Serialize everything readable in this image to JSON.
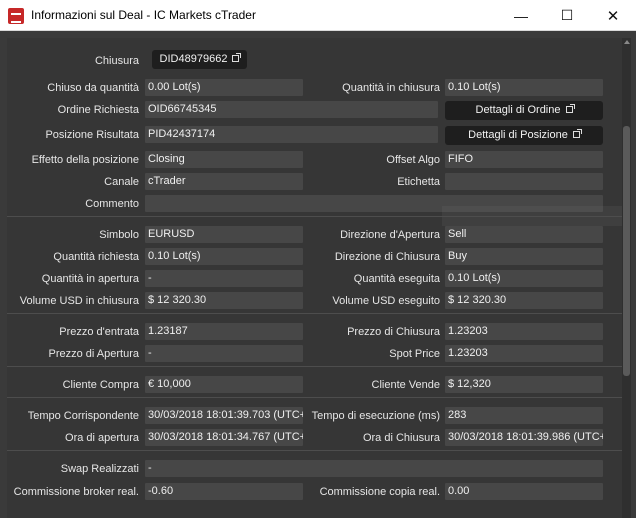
{
  "window": {
    "title": "Informazioni sul Deal - IC Markets cTrader",
    "minimize": "—",
    "maximize": "☐",
    "close": "✕"
  },
  "chiusura": {
    "label": "Chiusura",
    "deal_id": "DID48979662"
  },
  "rows": {
    "chiuso_quantita": {
      "label": "Chiuso da quantità",
      "value": "0.00 Lot(s)"
    },
    "quantita_chiusura": {
      "label": "Quantità in chiusura",
      "value": "0.10 Lot(s)"
    },
    "ordine_richiesta": {
      "label": "Ordine Richiesta",
      "value": "OID66745345"
    },
    "posizione_risultata": {
      "label": "Posizione Risultata",
      "value": "PID42437174"
    },
    "effetto_posizione": {
      "label": "Effetto della posizione",
      "value": "Closing"
    },
    "offset_algo": {
      "label": "Offset Algo",
      "value": "FIFO"
    },
    "canale": {
      "label": "Canale",
      "value": "cTrader"
    },
    "etichetta": {
      "label": "Etichetta",
      "value": ""
    },
    "commento": {
      "label": "Commento",
      "value": ""
    },
    "simbolo": {
      "label": "Simbolo",
      "value": "EURUSD"
    },
    "direzione_apertura": {
      "label": "Direzione d'Apertura",
      "value": "Sell"
    },
    "quantita_richiesta": {
      "label": "Quantità richiesta",
      "value": "0.10 Lot(s)"
    },
    "direzione_chiusura": {
      "label": "Direzione di Chiusura",
      "value": "Buy"
    },
    "quantita_apertura": {
      "label": "Quantità in apertura",
      "value": "-"
    },
    "quantita_eseguita": {
      "label": "Quantità eseguita",
      "value": "0.10 Lot(s)"
    },
    "volume_usd_chiusura": {
      "label": "Volume USD in chiusura",
      "value": "$ 12 320.30"
    },
    "volume_usd_eseguito": {
      "label": "Volume USD eseguito",
      "value": "$ 12 320.30"
    },
    "prezzo_entrata": {
      "label": "Prezzo d'entrata",
      "value": "1.23187"
    },
    "prezzo_chiusura": {
      "label": "Prezzo di Chiusura",
      "value": "1.23203"
    },
    "prezzo_apertura": {
      "label": "Prezzo di Apertura",
      "value": "-"
    },
    "spot_price": {
      "label": "Spot Price",
      "value": "1.23203"
    },
    "cliente_compra": {
      "label": "Cliente Compra",
      "value": "€ 10,000"
    },
    "cliente_vende": {
      "label": "Cliente Vende",
      "value": "$ 12,320"
    },
    "tempo_corrispondente": {
      "label": "Tempo Corrispondente",
      "value": "30/03/2018 18:01:39.703 (UTC+"
    },
    "tempo_esecuzione": {
      "label": "Tempo di esecuzione (ms)",
      "value": "283"
    },
    "ora_apertura": {
      "label": "Ora di apertura",
      "value": "30/03/2018 18:01:34.767 (UTC+"
    },
    "ora_chiusura": {
      "label": "Ora di Chiusura",
      "value": "30/03/2018 18:01:39.986 (UTC+"
    },
    "swap_realizzati": {
      "label": "Swap Realizzati",
      "value": "-"
    },
    "commissione_broker": {
      "label": "Commissione broker real.",
      "value": "-0.60"
    },
    "commissione_copia": {
      "label": "Commissione copia real.",
      "value": "0.00"
    }
  },
  "buttons": {
    "dettagli_ordine": "Dettagli di Ordine",
    "dettagli_posizione": "Dettagli di Posizione"
  }
}
